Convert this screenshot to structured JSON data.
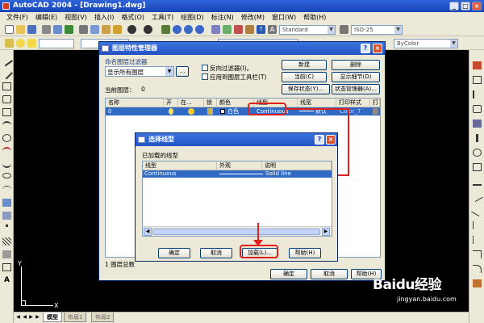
{
  "app": {
    "title": "AutoCAD 2004 - [Drawing1.dwg]"
  },
  "menu": [
    "文件(F)",
    "编辑(E)",
    "视图(V)",
    "插入(I)",
    "格式(O)",
    "工具(T)",
    "绘图(D)",
    "标注(N)",
    "修改(M)",
    "窗口(W)",
    "帮助(H)"
  ],
  "toolbar": {
    "text_style": "Standard",
    "dim_style": "ISO-25",
    "lineweight": "ByColor"
  },
  "layer_dialog": {
    "title": "图层特性管理器",
    "filter_label": "命名图层过滤器",
    "filter_value": "显示所有图层",
    "filter_more": "...",
    "invert_filter": "反向过滤器(I)。",
    "apply_toolbar": "应用到图层工具栏(T)",
    "current_layer_label": "当前图层：",
    "current_layer_value": "0",
    "buttons": {
      "new": "新建",
      "delete": "删除",
      "current": "当前(C)",
      "show_details": "显示细节(D)",
      "save_state": "保存状态(Y)...",
      "state_manager": "状态管理器(A)...",
      "ok": "确定",
      "cancel": "取消",
      "help": "帮助(H)"
    },
    "columns": [
      "名称",
      "开",
      "在...",
      "锁",
      "颜色",
      "线型",
      "线宽",
      "打印样式",
      "打."
    ],
    "row": {
      "name": "0",
      "color": "白色",
      "linetype": "Continuous",
      "lineweight": "默认",
      "plot_style": "Color_7"
    },
    "status": "1 图层总数"
  },
  "linetype_dialog": {
    "title": "选择线型",
    "section_label": "已加载的线型",
    "columns": [
      "线型",
      "外观",
      "说明"
    ],
    "row": {
      "linetype": "Continuous",
      "description": "Solid line"
    },
    "buttons": {
      "ok": "确定",
      "cancel": "取消",
      "load": "加载(L)...",
      "help": "帮助(H)"
    }
  },
  "tabs": [
    "模型",
    "布局1",
    "布局2"
  ],
  "ucs": {
    "y": "Y",
    "x": "X"
  },
  "watermark": {
    "logo": "Baidu经验",
    "url": "jingyan.baidu.com"
  }
}
